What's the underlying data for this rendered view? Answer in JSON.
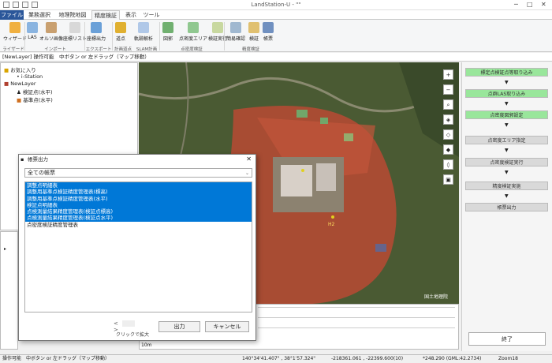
{
  "window": {
    "title": "LandStation-U - \"\""
  },
  "tabs": [
    "ファイル",
    "業務選択",
    "地理院地図",
    "精度検証",
    "表示",
    "ツール"
  ],
  "ribbon": {
    "buttons": [
      {
        "label": "ウィザード"
      },
      {
        "label": "LAS"
      },
      {
        "label": "オルソ画像"
      },
      {
        "label": "座標リスト"
      },
      {
        "label": "座標出力"
      },
      {
        "label": "道点"
      },
      {
        "label": "軌跡解析"
      },
      {
        "label": "図郭"
      },
      {
        "label": "点密度エリア"
      },
      {
        "label": "検証実行"
      },
      {
        "label": "簡易確認"
      },
      {
        "label": "検証"
      },
      {
        "label": "帳票"
      }
    ],
    "groups": [
      "ライザード",
      "インポート",
      "エクスポート",
      "計画道点",
      "SLAM計画",
      "点密度検証",
      "精度検証"
    ]
  },
  "layer_bar": "[NewLayer] 操作可能　中ボタン or 左ドラッグ（マップ移動）",
  "tree": {
    "favorites": "お気に入り",
    "station": "i-Station",
    "layer": "NewLayer",
    "items": [
      "検証点(水平)",
      "基準点(水平)"
    ]
  },
  "map": {
    "copyright": "国土地理院",
    "scale": "10m",
    "marker": "H2"
  },
  "workflow": {
    "steps": [
      "標定点検証点等取り込み",
      "点群LAS取り込み",
      "点密度図郭設定",
      "点密度エリア指定",
      "点密度検証実行",
      "精度検証実施",
      "帳票出力"
    ],
    "end_button": "終了"
  },
  "dialog": {
    "title": "帳票出力",
    "select_value": "全ての帳票",
    "items": [
      "調整点明細表",
      "調整用基準点検証精度管理表(標高)",
      "調整用基準点検証精度管理表(水平)",
      "検証点明細表",
      "点検測量結果精度管理表(検証点標高)",
      "点検測量結果精度管理表(検証点水平)",
      "点密度検証精度管理表"
    ],
    "nav_prev": "<",
    "nav_next": ">",
    "zoom_hint": "クリックで拡大",
    "output_button": "出力",
    "cancel_button": "キャンセル"
  },
  "status": {
    "mode": "操作可能　中ボタン or 左ドラッグ（マップ移動）",
    "latlon": "140°34'41.407\" , 38°1'57.324\"",
    "xy": "-218361.061 , -22399.600(10)",
    "elev": "*248.290 (GML:42.2734)",
    "zoom": "Zoom18"
  },
  "colors": {
    "accent": "#2b579a",
    "selection": "#0078d7",
    "step_done": "#99e69b",
    "step_todo": "#d9d9d9"
  }
}
